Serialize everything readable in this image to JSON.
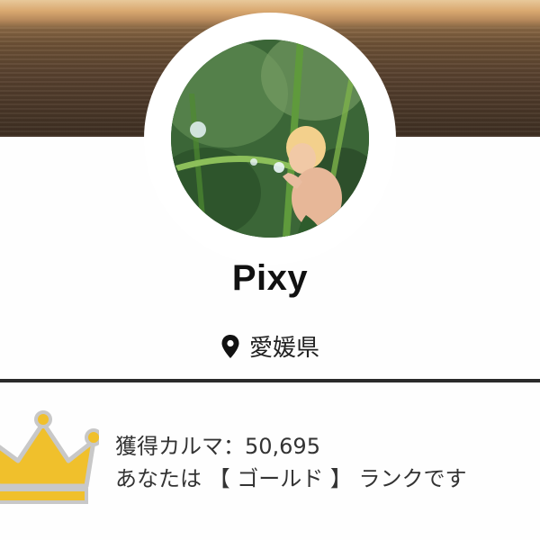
{
  "profile": {
    "name": "Pixy",
    "location": "愛媛県",
    "location_icon": "map-pin-icon",
    "avatar_icon": "avatar-photo"
  },
  "karma": {
    "label": "獲得カルマ：50,695",
    "rank_text": "あなたは 【 ゴールド 】 ランクです",
    "rank_icon": "crown-icon",
    "rank_color": "#f0c02c"
  },
  "colors": {
    "divider": "#2b2b2b",
    "crown_fill": "#f0c02c",
    "crown_stroke": "#c6c6c6"
  }
}
